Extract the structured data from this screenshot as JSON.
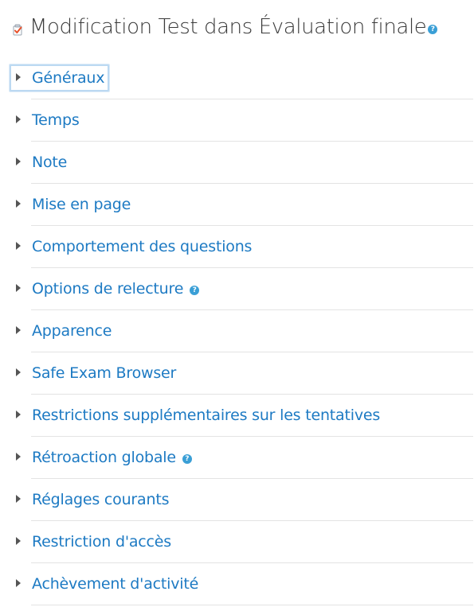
{
  "header": {
    "title": "Modification Test dans Évaluation finale",
    "module_icon": "quiz-icon",
    "help_icon": "help-icon",
    "help_glyph": "?"
  },
  "colors": {
    "link": "#1d7ac3",
    "help": "#3a9fd6",
    "title": "#3a3a3a",
    "divider": "#e3e3e3"
  },
  "sections": [
    {
      "label": "Généraux",
      "focused": true,
      "help": false
    },
    {
      "label": "Temps",
      "focused": false,
      "help": false
    },
    {
      "label": "Note",
      "focused": false,
      "help": false
    },
    {
      "label": "Mise en page",
      "focused": false,
      "help": false
    },
    {
      "label": "Comportement des questions",
      "focused": false,
      "help": false
    },
    {
      "label": "Options de relecture",
      "focused": false,
      "help": true
    },
    {
      "label": "Apparence",
      "focused": false,
      "help": false
    },
    {
      "label": "Safe Exam Browser",
      "focused": false,
      "help": false
    },
    {
      "label": "Restrictions supplémentaires sur les tentatives",
      "focused": false,
      "help": false
    },
    {
      "label": "Rétroaction globale",
      "focused": false,
      "help": true
    },
    {
      "label": "Réglages courants",
      "focused": false,
      "help": false
    },
    {
      "label": "Restriction d'accès",
      "focused": false,
      "help": false
    },
    {
      "label": "Achèvement d'activité",
      "focused": false,
      "help": false
    }
  ]
}
